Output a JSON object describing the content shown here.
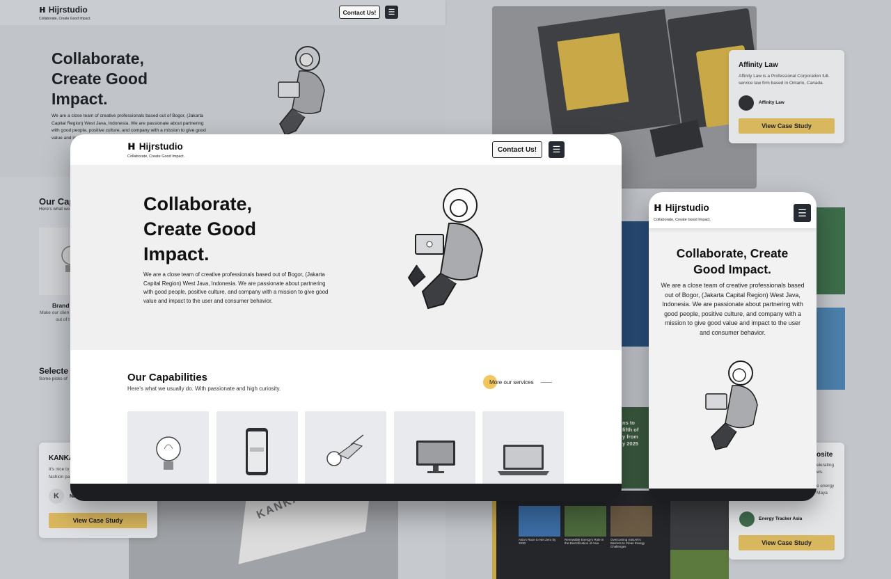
{
  "brand": {
    "name": "Hijrstudio",
    "tagline": "Collaborate, Create Good Impact."
  },
  "nav": {
    "contact_label": "Contact Us!",
    "menu_icon": "hamburger-icon"
  },
  "hero": {
    "title_line1": "Collaborate,",
    "title_line2": "Create Good",
    "title_line3": "Impact.",
    "mobile_title": "Collaborate, Create Good Impact.",
    "body": "We are a close team of creative professionals based out of Bogor, (Jakarta Capital Region) West Java, Indonesia. We are passionate about partnering with good people, positive culture, and company with a mission to give good value and impact to the user and consumer behavior."
  },
  "capabilities": {
    "title": "Our Capabilities",
    "subtitle": "Here's what we usually do. With passionate and high curiosity.",
    "more_link": "More our services",
    "bg_title_fragment": "Our Cap",
    "bg_subtitle_fragment": "Here's what we",
    "bg_card_label": "Brand",
    "bg_card_text_1": "Make our clien",
    "bg_card_text_2": "out of t"
  },
  "selected": {
    "title_fragment": "Selecte",
    "subtitle_fragment": "Some picks of"
  },
  "case_affinity": {
    "title": "Affinity Law",
    "description": "Affinity Law is a Professional Corporation full-service law firm based in Ontario, Canada.",
    "client_name": "Affinity Law",
    "cta": "View Case Study"
  },
  "case_kanka": {
    "title_fragment": "KANKA",
    "text_1": "It's nice to",
    "text_2": "fashion pa",
    "client_fragment": "Na",
    "cta": "View Case Study",
    "brand_print": "KANKA"
  },
  "case_energy": {
    "title_fragment": "osite",
    "text_1": "elerating",
    "text_2": "ws.",
    "text_3": "e energy",
    "text_4": "Maya",
    "client_name": "Energy Tracker Asia",
    "cta": "View Case Study"
  },
  "news": {
    "items": [
      "Asia's Race to Net Zero by 2030",
      "Renewable Energy's Role in the Electrification of Asia",
      "Overcoming ASEAN's Barriers to Clean Energy Challenges"
    ]
  },
  "magazine": {
    "line1": "ns to",
    "line2": "fifth of",
    "line3": "y from",
    "line4": "y 2025"
  },
  "colors": {
    "accent_yellow": "#d9b75e",
    "dark": "#262a31",
    "bg_gray": "#c3c6cb"
  }
}
